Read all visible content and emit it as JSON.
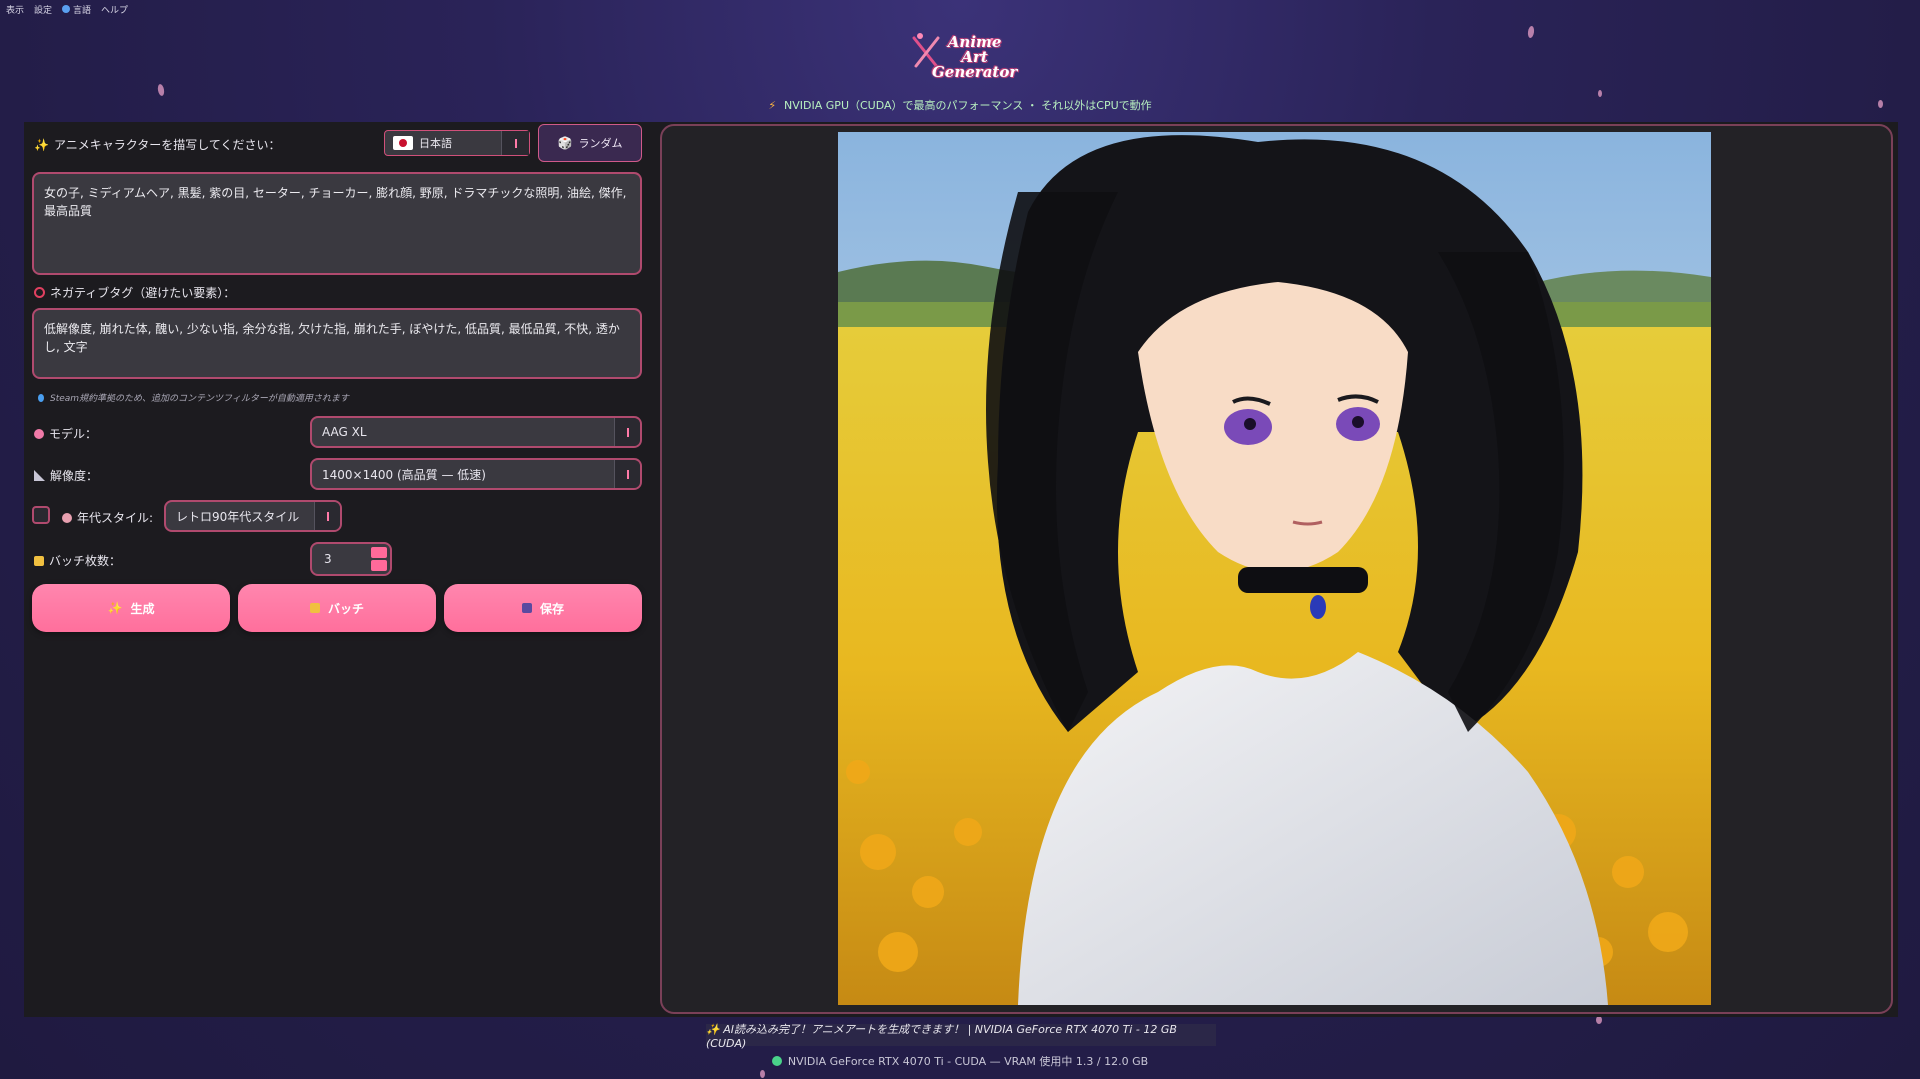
{
  "menu": {
    "items": [
      "表示",
      "設定",
      "言語",
      "ヘルプ"
    ]
  },
  "app": {
    "logo_line1": "Anime Art",
    "logo_line2": "Generator"
  },
  "gpu_banner": "NVIDIA GPU（CUDA）で最高のパフォーマンス ・ それ以外はCPUで動作",
  "prompt": {
    "label": "アニメキャラクターを描写してください：",
    "value": "女の子, ミディアムヘア, 黒髪, 紫の目, セーター, チョーカー, 膨れ顔, 野原, ドラマチックな照明, 油絵, 傑作, 最高品質"
  },
  "language_select": {
    "value": "日本語"
  },
  "random_button": "ランダム",
  "negative": {
    "label": "ネガティブタグ（避けたい要素）：",
    "value": "低解像度, 崩れた体, 醜い, 少ない指, 余分な指, 欠けた指, 崩れた手, ぼやけた, 低品質, 最低品質, 不快, 透かし, 文字"
  },
  "note": "Steam規約準拠のため、追加のコンテンツフィルターが自動適用されます",
  "model": {
    "label": "モデル：",
    "value": "AAG XL"
  },
  "resolution": {
    "label": "解像度：",
    "value": "1400×1400 (高品質 — 低速)"
  },
  "era_style": {
    "label": "年代スタイル:",
    "value": "レトロ90年代スタイル",
    "checked": false
  },
  "batch": {
    "label": "バッチ枚数：",
    "value": "3"
  },
  "buttons": {
    "generate": "生成",
    "batch": "バッチ",
    "save": "保存"
  },
  "status": "✨ AI読み込み完了！アニメアートを生成できます！ | NVIDIA GeForce RTX 4070 Ti - 12 GB (CUDA)",
  "vram_status": "NVIDIA GeForce RTX 4070 Ti - CUDA — VRAM 使用中 1.3 / 12.0 GB",
  "colors": {
    "accent": "#ff6f9c",
    "border": "#b04a6e",
    "panel": "#1c1b1f",
    "background": "#2a2358"
  }
}
